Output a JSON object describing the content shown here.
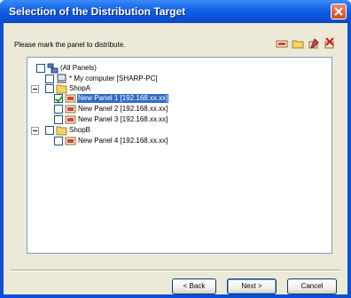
{
  "window": {
    "title": "Selection of the Distribution Target"
  },
  "instruction": "Please mark the panel to distribute.",
  "toolbar": {
    "icons": [
      "panel-icon",
      "folder-icon",
      "edit-icon",
      "delete-icon"
    ]
  },
  "tree": {
    "root": {
      "label": "(All Panels)",
      "checked": false
    },
    "computer": {
      "label": "* My computer [SHARP-PC]",
      "checked": false
    },
    "groups": [
      {
        "label": "ShopA",
        "expanded": true,
        "panels": [
          {
            "label": "New Panel 1 [192.168.xx.xx]",
            "checked": true,
            "selected": true
          },
          {
            "label": "New Panel 2 [192.168.xx.xx]",
            "checked": false,
            "selected": false
          },
          {
            "label": "New Panel 3 [192.168.xx.xx]",
            "checked": false,
            "selected": false
          }
        ]
      },
      {
        "label": "ShopB",
        "expanded": true,
        "panels": [
          {
            "label": "New Panel 4 [192.168.xx.xx]",
            "checked": false,
            "selected": false
          }
        ]
      }
    ]
  },
  "buttons": {
    "back": "< Back",
    "next": "Next >",
    "cancel": "Cancel"
  },
  "colors": {
    "titlebar": "#0a52d6",
    "selection": "#316ac5",
    "check": "#21a121"
  }
}
